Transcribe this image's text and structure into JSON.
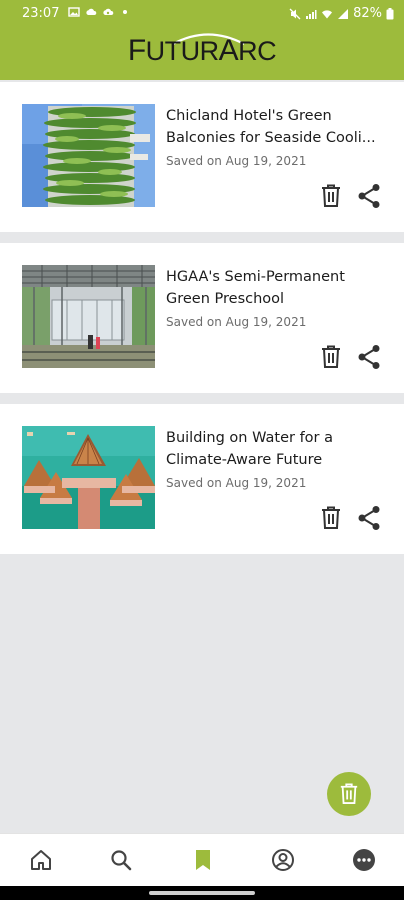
{
  "status_bar": {
    "time": "23:07",
    "battery": "82%"
  },
  "app": {
    "logo_text_big": "F",
    "logo_text_rest": "UTUR",
    "logo_text_big2": "A",
    "logo_text_rest2": "RC",
    "accent_color": "#9dbb3c"
  },
  "saved_articles": [
    {
      "title": "Chicland Hotel's Green Balconies for Seaside Cooli...",
      "saved_label": "Saved on Aug 19, 2021",
      "image": "vertical green tower hotel"
    },
    {
      "title": "HGAA's Semi-Permanent Green Preschool",
      "saved_label": "Saved on Aug 19, 2021",
      "image": "steel canopy preschool with plants"
    },
    {
      "title": "Building on Water for a Climate-Aware Future",
      "saved_label": "Saved on Aug 19, 2021",
      "image": "floating bamboo pavilions on turquoise water"
    }
  ],
  "icons": {
    "delete": "trash-icon",
    "share": "share-icon",
    "fab": "trash-icon"
  },
  "bottom_nav": [
    "home-icon",
    "search-icon",
    "bookmark-icon",
    "profile-icon",
    "more-icon"
  ],
  "bottom_nav_active": "bookmark-icon"
}
